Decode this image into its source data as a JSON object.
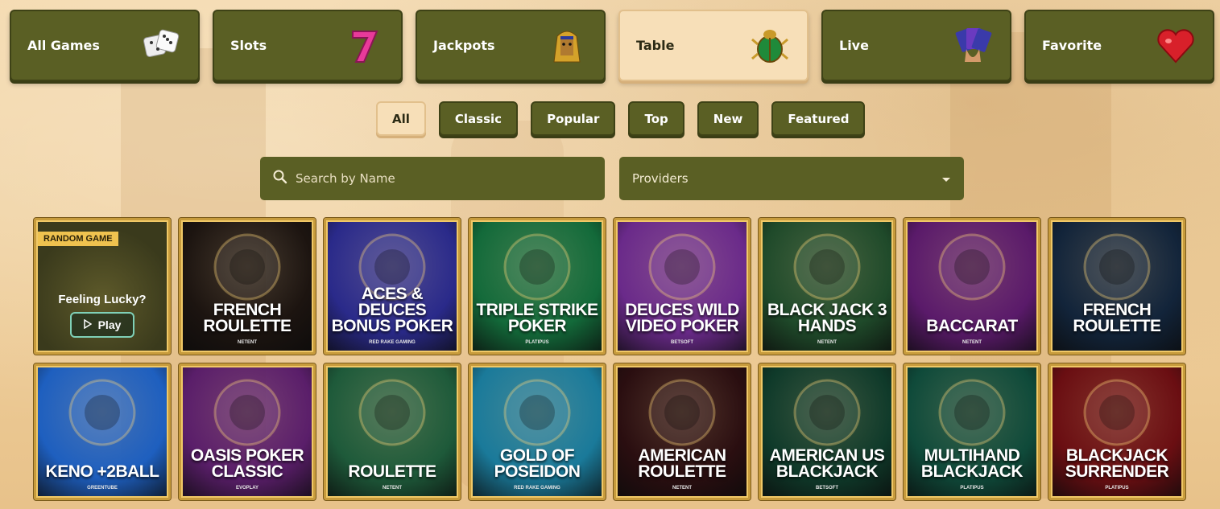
{
  "categories": [
    {
      "label": "All Games",
      "icon": "dice-icon",
      "active": false
    },
    {
      "label": "Slots",
      "icon": "seven-icon",
      "active": false
    },
    {
      "label": "Jackpots",
      "icon": "pharaoh-icon",
      "active": false
    },
    {
      "label": "Table",
      "icon": "scarab-icon",
      "active": true
    },
    {
      "label": "Live",
      "icon": "cards-hand-icon",
      "active": false
    },
    {
      "label": "Favorite",
      "icon": "heart-icon",
      "active": false
    }
  ],
  "filters": [
    {
      "label": "All",
      "active": true
    },
    {
      "label": "Classic",
      "active": false
    },
    {
      "label": "Popular",
      "active": false
    },
    {
      "label": "Top",
      "active": false
    },
    {
      "label": "New",
      "active": false
    },
    {
      "label": "Featured",
      "active": false
    }
  ],
  "search": {
    "placeholder": "Search by Name"
  },
  "providers": {
    "label": "Providers"
  },
  "random_tile": {
    "badge": "RANDOM GAME",
    "prompt": "Feeling Lucky?",
    "play_label": "Play"
  },
  "games": [
    {
      "title": "FRENCH ROULETTE",
      "provider": "NETENT",
      "bg": "#1c1410"
    },
    {
      "title": "ACES & DEUCES BONUS POKER",
      "provider": "RED RAKE GAMING",
      "bg": "#2a2a8a"
    },
    {
      "title": "TRIPLE STRIKE POKER",
      "provider": "PLATIPUS",
      "bg": "#136a3a"
    },
    {
      "title": "DEUCES WILD VIDEO POKER",
      "provider": "BETSOFT",
      "bg": "#6a2a8a"
    },
    {
      "title": "BLACK JACK 3 HANDS",
      "provider": "NETENT",
      "bg": "#1f4a2a"
    },
    {
      "title": "BACCARAT",
      "provider": "NETENT",
      "bg": "#5a1a6a"
    },
    {
      "title": "FRENCH ROULETTE",
      "provider": "",
      "bg": "#12243a"
    },
    {
      "title": "KENO +2BALL",
      "provider": "GREENTUBE",
      "bg": "#1e5fbf"
    },
    {
      "title": "OASIS POKER CLASSIC",
      "provider": "EVOPLAY",
      "bg": "#5a1e6a"
    },
    {
      "title": "ROULETTE",
      "provider": "NETENT",
      "bg": "#1e5a3a"
    },
    {
      "title": "GOLD OF POSEIDON",
      "provider": "RED RAKE GAMING",
      "bg": "#1a7a9a"
    },
    {
      "title": "AMERICAN ROULETTE",
      "provider": "NETENT",
      "bg": "#2a0e10"
    },
    {
      "title": "AMERICAN US BLACKJACK",
      "provider": "BETSOFT",
      "bg": "#0f3a2a"
    },
    {
      "title": "MULTIHAND BLACKJACK",
      "provider": "PLATIPUS",
      "bg": "#0f4a3a"
    },
    {
      "title": "BLACKJACK SURRENDER",
      "provider": "PLATIPUS",
      "bg": "#6a0e12"
    }
  ]
}
